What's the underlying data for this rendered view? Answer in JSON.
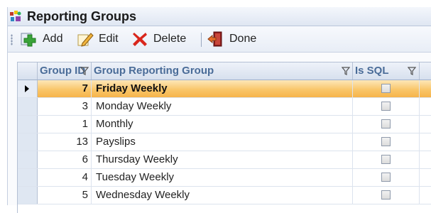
{
  "window": {
    "title": "Reporting Groups"
  },
  "toolbar": {
    "add_label": "Add",
    "edit_label": "Edit",
    "delete_label": "Delete",
    "done_label": "Done"
  },
  "grid": {
    "columns": [
      "Group ID",
      "Group Reporting Group",
      "Is SQL"
    ],
    "rows": [
      {
        "id": "7",
        "name": "Friday Weekly",
        "is_sql": false,
        "selected": true
      },
      {
        "id": "3",
        "name": "Monday Weekly",
        "is_sql": false
      },
      {
        "id": "1",
        "name": "Monthly",
        "is_sql": false
      },
      {
        "id": "13",
        "name": "Payslips",
        "is_sql": false
      },
      {
        "id": "6",
        "name": "Thursday Weekly",
        "is_sql": false
      },
      {
        "id": "4",
        "name": "Tuesday Weekly",
        "is_sql": false
      },
      {
        "id": "5",
        "name": "Wednesday Weekly",
        "is_sql": false
      }
    ]
  },
  "colors": {
    "header_text": "#4a6c98",
    "selection": "#f9c66a",
    "delete_icon": "#d9261c",
    "add_icon": "#3aa33a"
  },
  "icons": [
    "app-icon",
    "add-icon",
    "edit-icon",
    "delete-icon",
    "done-icon",
    "filter-icon",
    "row-indicator-arrow"
  ]
}
